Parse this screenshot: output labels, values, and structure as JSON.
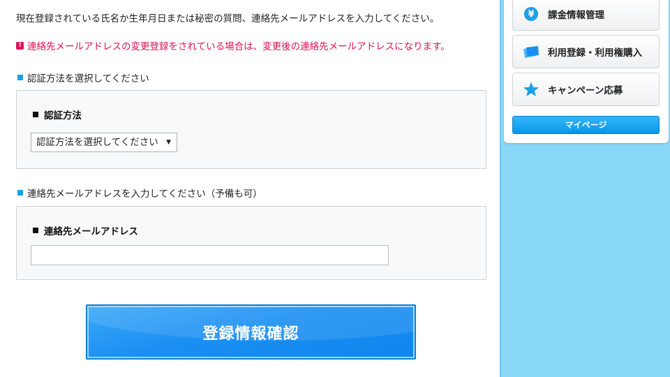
{
  "intro_text": "現在登録されている氏名か生年月日または秘密の質問、連絡先メールアドレスを入力してください。",
  "warning_text": "連絡先メールアドレスの変更登録をされている場合は、変更後の連絡先メールアドレスになります。",
  "auth_section": {
    "heading": "認証方法を選択してください",
    "label": "認証方法",
    "select_value": "認証方法を選択してください"
  },
  "email_section": {
    "heading": "連絡先メールアドレスを入力してください（予備も可）",
    "label": "連絡先メールアドレス",
    "input_value": ""
  },
  "submit_label": "登録情報確認",
  "sidebar": {
    "items": [
      {
        "label": "課金情報管理",
        "icon": "yen-icon"
      },
      {
        "label": "利用登録・利用権購入",
        "icon": "ticket-icon"
      },
      {
        "label": "キャンペーン応募",
        "icon": "star-icon"
      }
    ],
    "mypage_label": "マイページ"
  },
  "colors": {
    "accent": "#1a8ff2",
    "warning": "#e0105a",
    "background": "#8ad8f8"
  }
}
